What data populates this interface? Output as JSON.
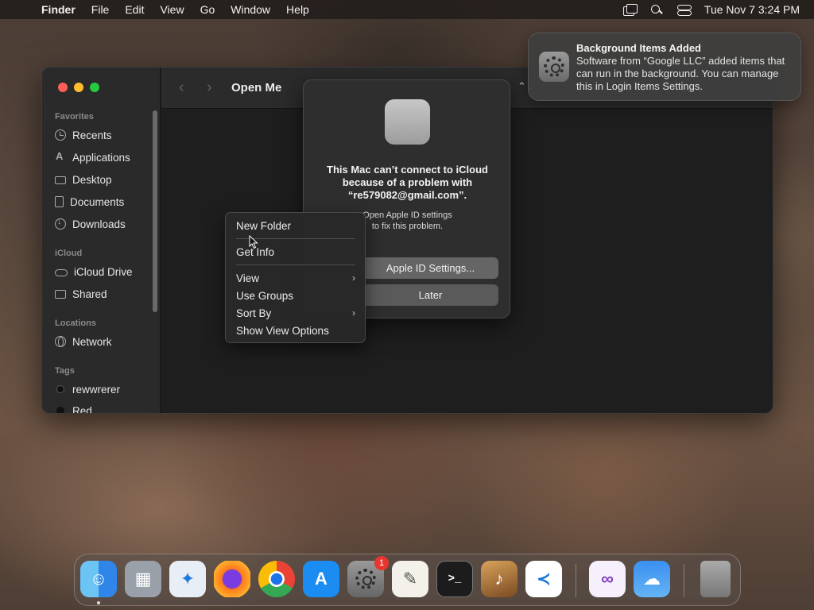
{
  "menubar": {
    "app_name": "Finder",
    "menus": [
      "File",
      "Edit",
      "View",
      "Go",
      "Window",
      "Help"
    ],
    "clock": "Tue Nov 7  3:24 PM"
  },
  "finder": {
    "title": "Open Me",
    "sidebar": {
      "favorites_label": "Favorites",
      "favorites": [
        "Recents",
        "Applications",
        "Desktop",
        "Documents",
        "Downloads"
      ],
      "icloud_label": "iCloud",
      "icloud": [
        "iCloud Drive",
        "Shared"
      ],
      "locations_label": "Locations",
      "locations": [
        "Network"
      ],
      "tags_label": "Tags",
      "tags": [
        "rewwrerer",
        "Red"
      ]
    }
  },
  "dialog": {
    "title": "This Mac can’t connect to iCloud because of a problem with “re579082@gmail.com”.",
    "message": "Open Apple ID settings to fix this problem.",
    "primary_button": "Apple ID Settings...",
    "secondary_button": "Later"
  },
  "context_menu": {
    "items": [
      "New Folder",
      "Get Info",
      "View",
      "Use Groups",
      "Sort By",
      "Show View Options"
    ]
  },
  "notification": {
    "title": "Background Items Added",
    "body": "Software from “Google LLC” added items that can run in the background. You can manage this in Login Items Settings."
  },
  "dock": {
    "apps": [
      "Finder",
      "Launchpad",
      "Safari",
      "Firefox",
      "Chrome",
      "App Store",
      "System Settings",
      "TextEdit",
      "Terminal",
      "Instruments",
      "Visual Studio Code",
      "Visual Studio",
      "Weather",
      "Trash"
    ],
    "settings_badge": "1",
    "terminal_glyph": ">_"
  },
  "colors": {
    "close": "#fe5f57",
    "minimize": "#febc2e",
    "maximize": "#28c840",
    "badge": "#e8362f"
  }
}
